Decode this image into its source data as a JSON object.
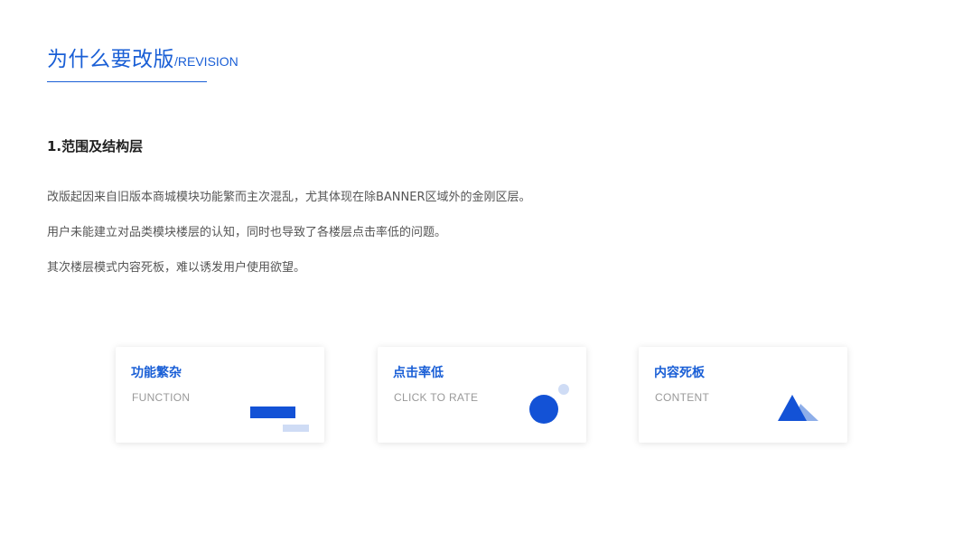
{
  "header": {
    "title": "为什么要改版",
    "subtitle": "/REVISION"
  },
  "section": {
    "heading": "1.范围及结构层",
    "paragraphs": [
      "改版起因来自旧版本商城模块功能繁而主次混乱，尤其体现在除BANNER区域外的金刚区层。",
      "用户未能建立对品类模块楼层的认知，同时也导致了各楼层点击率低的问题。",
      "其次楼层模式内容死板，难以诱发用户使用欲望。"
    ]
  },
  "cards": [
    {
      "title": "功能繁杂",
      "subtitle": "FUNCTION",
      "icon": "bars-icon"
    },
    {
      "title": "点击率低",
      "subtitle": "CLICK TO RATE",
      "icon": "circles-icon"
    },
    {
      "title": "内容死板",
      "subtitle": "CONTENT",
      "icon": "triangles-icon"
    }
  ],
  "colors": {
    "accent": "#1a5fd6",
    "icon_dark": "#1352d6",
    "icon_light": "#cfdcf5"
  }
}
